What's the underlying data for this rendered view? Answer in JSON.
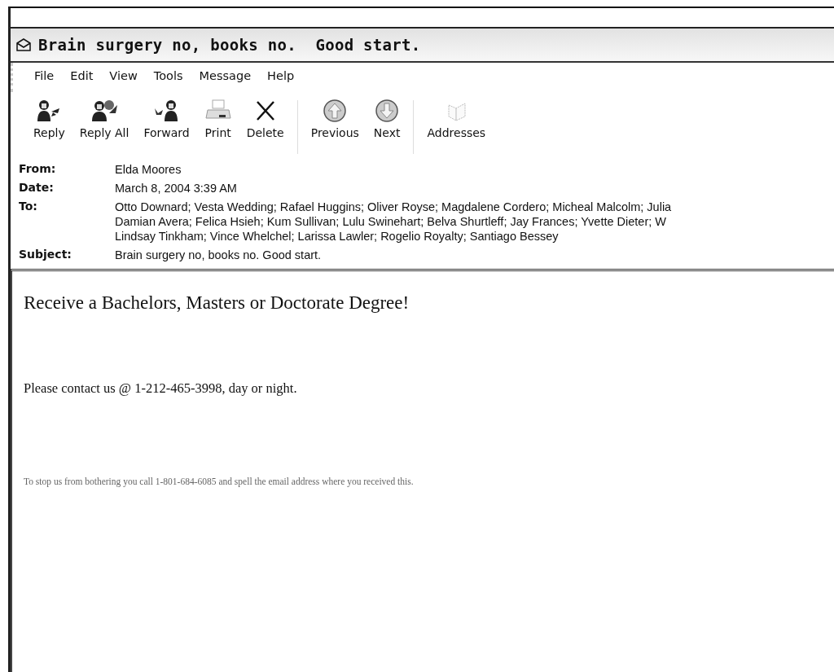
{
  "window": {
    "title": "Brain surgery no, books no.  Good start."
  },
  "menu": [
    "File",
    "Edit",
    "View",
    "Tools",
    "Message",
    "Help"
  ],
  "toolbar": [
    {
      "label": "Reply",
      "kind": "reply",
      "disabled": false
    },
    {
      "label": "Reply All",
      "kind": "replyall",
      "disabled": false
    },
    {
      "label": "Forward",
      "kind": "forward",
      "disabled": false
    },
    {
      "label": "Print",
      "kind": "print",
      "disabled": false
    },
    {
      "label": "Delete",
      "kind": "delete",
      "disabled": false
    },
    {
      "label": "Previous",
      "kind": "previous",
      "disabled": false
    },
    {
      "label": "Next",
      "kind": "next",
      "disabled": false
    },
    {
      "label": "Addresses",
      "kind": "addresses",
      "disabled": false
    }
  ],
  "header": [
    {
      "label": "From:",
      "lines": [
        "Elda Moores"
      ]
    },
    {
      "label": "Date:",
      "lines": [
        "March 8, 2004 3:39 AM"
      ]
    },
    {
      "label": "To:",
      "lines": [
        "Otto Downard; Vesta Wedding; Rafael Huggins; Oliver Royse; Magdalene Cordero; Micheal Malcolm; Julia",
        "Damian Avera; Felica Hsieh; Kum Sullivan; Lulu Swinehart; Belva Shurtleff; Jay Frances; Yvette Dieter; W",
        "Lindsay Tinkham; Vince Whelchel; Larissa Lawler; Rogelio Royalty; Santiago Bessey"
      ]
    },
    {
      "label": "Subject:",
      "lines": [
        "Brain surgery no, books no.  Good start."
      ]
    }
  ],
  "body": [
    {
      "kind": "heading",
      "text": "Receive a Bachelors, Masters or Doctorate Degree!"
    },
    {
      "kind": "paragraph",
      "text": "Please contact us @ 1-212-465-3998, day or night."
    },
    {
      "kind": "fineprint",
      "text": "To stop us from bothering you call 1-801-684-6085 and spell the email address where you received this."
    }
  ]
}
